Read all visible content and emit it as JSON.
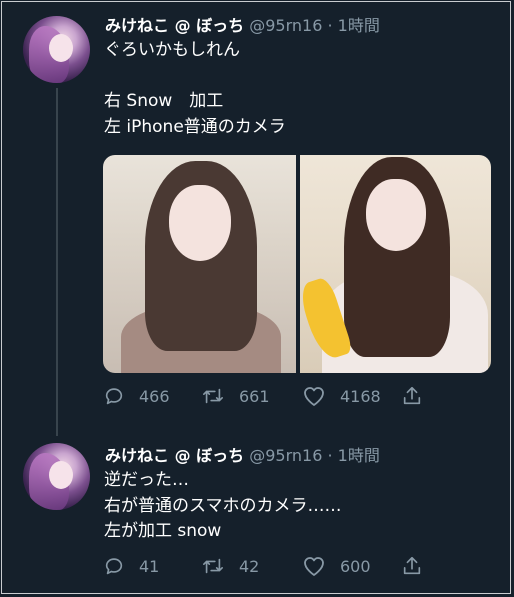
{
  "tweets": [
    {
      "display_name": "みけねこ @ ぼっち",
      "handle_time": "@95rn16 · 1時間",
      "text": "ぐろいかもしれん\n\n右 Snow　加工\n左 iPhone普通のカメラ",
      "actions": {
        "reply": "466",
        "retweet": "661",
        "like": "4168"
      }
    },
    {
      "display_name": "みけねこ @ ぼっち",
      "handle_time": "@95rn16 · 1時間",
      "text": "逆だった…\n右が普通のスマホのカメラ……\n左が加工 snow",
      "actions": {
        "reply": "41",
        "retweet": "42",
        "like": "600"
      }
    }
  ],
  "icons": {
    "reply": "reply-icon",
    "retweet": "retweet-icon",
    "like": "like-icon",
    "share": "share-icon"
  },
  "colors": {
    "background": "#15202b",
    "secondary_text": "#8899a6",
    "thread_line": "#38444d"
  }
}
